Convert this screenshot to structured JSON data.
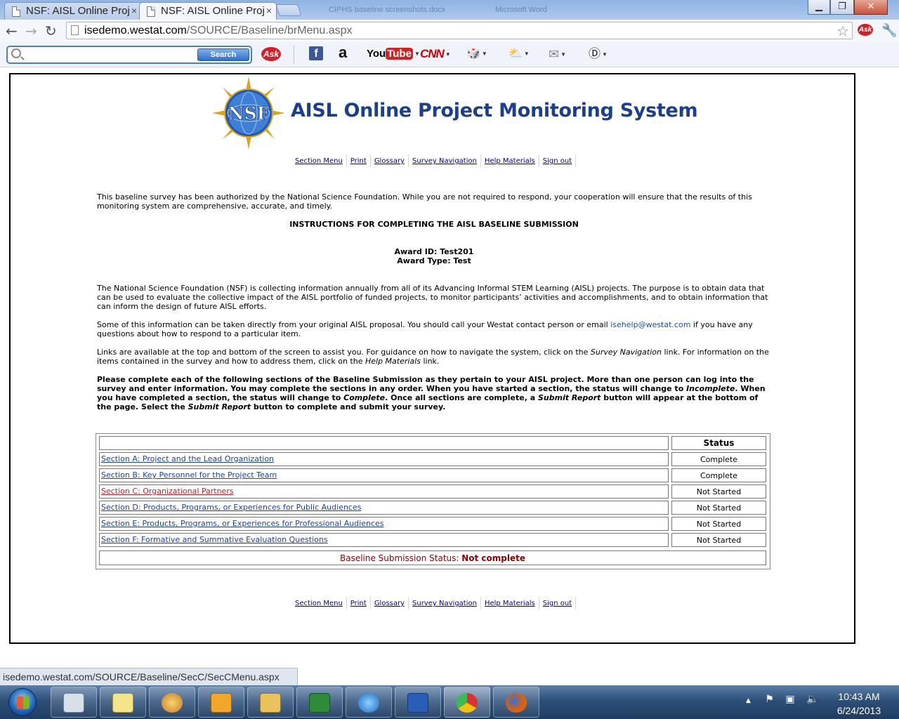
{
  "browser": {
    "tabs": [
      {
        "title": "NSF: AISL Online Proj"
      },
      {
        "title": "NSF: AISL Online Proj"
      }
    ],
    "ghost_titles": [
      "CIPHS baseline screenshots.docx",
      "Microsoft Word"
    ],
    "url_host": "isedemo.westat.com",
    "url_path": "/SOURCE/Baseline/brMenu.aspx",
    "search_button": "Search",
    "search_placeholder": "",
    "toolbar_icons": [
      "ask-icon",
      "facebook-icon",
      "amazon-icon",
      "youtube-icon",
      "cnn-icon",
      "games-icon",
      "weather-icon",
      "mail-icon",
      "dictionary-icon"
    ],
    "youtube_label": "You",
    "youtube_label2": "Tube",
    "cnn_label": "CNN",
    "ask_label": "Ask",
    "amazon_label": "a",
    "facebook_label": "f"
  },
  "page": {
    "logo_text": "NSF",
    "title": "AISL Online Project Monitoring System",
    "nav_links": [
      "Section Menu",
      "Print",
      "Glossary",
      "Survey Navigation",
      "Help Materials",
      "Sign out"
    ],
    "authorization": "This baseline survey has been authorized by the National Science Foundation. While you are not required to respond, your cooperation will ensure that the results of this monitoring system are comprehensive, accurate, and timely.",
    "instructions_heading": "INSTRUCTIONS FOR COMPLETING THE AISL BASELINE SUBMISSION",
    "award_id": "Award ID: Test201",
    "award_type": "Award Type: Test",
    "para1": "The National Science Foundation (NSF) is collecting information annually from all of its Advancing Informal STEM Learning (AISL) projects. The purpose is to obtain data that can be used to evaluate the collective impact of the AISL portfolio of funded projects, to monitor participants’ activities and accomplishments, and to obtain information that can inform the design of future AISL efforts.",
    "para2_before": "Some of this information can be taken directly from your original AISL proposal. You should call your Westat contact person or email ",
    "para2_email": "isehelp@westat.com",
    "para2_after": " if you have any questions about how to respond to a particular item.",
    "para3_a": "Links are available at the top and bottom of the screen to assist you. For guidance on how to navigate the system, click on the ",
    "para3_b": "Survey Navigation",
    "para3_c": " link. For information on the items contained in the survey and how to address them, click on the ",
    "para3_d": "Help Materials",
    "para3_e": " link.",
    "para4_a": "Please complete each of the following sections of the Baseline Submission as they pertain to your AISL project. More than one person can log into the survey and enter information. You may complete the sections in any order. When you have started a section, the status will change to ",
    "para4_b": "Incomplete",
    "para4_c": ". When you have completed a section, the status will change to ",
    "para4_d": "Complete",
    "para4_e": ". Once all sections are complete, a ",
    "para4_f": "Submit Report",
    "para4_g": " button will appear at the bottom of the page. Select the ",
    "para4_h": "Submit Report",
    "para4_i": " button to complete and submit your survey.",
    "table_header_status": "Status",
    "sections": [
      {
        "name": "Section A: Project and the Lead Organization",
        "status": "Complete"
      },
      {
        "name": "Section B: Key Personnel for the Project Team",
        "status": "Complete"
      },
      {
        "name": "Section C: Organizational Partners",
        "status": "Not Started"
      },
      {
        "name": "Section D: Products, Programs, or Experiences for Public Audiences",
        "status": "Not Started"
      },
      {
        "name": "Section E: Products, Programs, or Experiences for Professional Audiences",
        "status": "Not Started"
      },
      {
        "name": "Section F: Formative and Summative Evaluation Questions",
        "status": "Not Started"
      }
    ],
    "submission_label": "Baseline Submission Status: ",
    "submission_value": "Not complete"
  },
  "statusbar": {
    "text": "isedemo.westat.com/SOURCE/Baseline/SecC/SecCMenu.aspx"
  },
  "taskbar": {
    "time": "10:43 AM",
    "date": "6/24/2013",
    "apps": [
      "task-manager-icon",
      "sticky-notes-icon",
      "paint-icon",
      "outlook-icon",
      "explorer-icon",
      "excel-icon",
      "ie-icon",
      "word-icon",
      "chrome-icon",
      "firefox-icon"
    ]
  },
  "colors": {
    "title_blue": "#1c3f8c",
    "link_blue": "#1a3fa6",
    "hover_red": "#c8202a",
    "status_red": "#8b0000"
  }
}
